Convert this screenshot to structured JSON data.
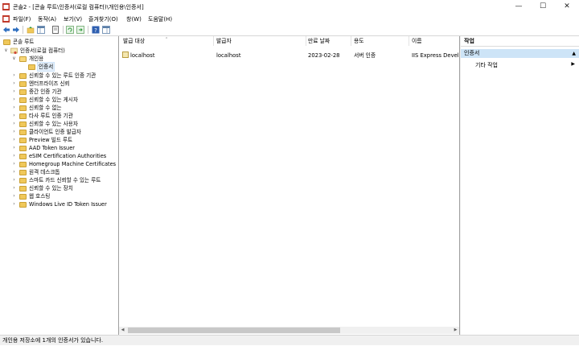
{
  "window": {
    "title": "콘솔2 - [콘솔 루트\\인증서(로컬 컴퓨터)\\개인용\\인증서]"
  },
  "menu": [
    "파일(F)",
    "동작(A)",
    "보기(V)",
    "즐겨찾기(O)",
    "창(W)",
    "도움말(H)"
  ],
  "tree": {
    "root": "콘솔 루트",
    "store": "인증서(로컬 컴퓨터)",
    "personal": "개인용",
    "certificates": "인증서",
    "folders": [
      "신뢰할 수 있는 루트 인증 기관",
      "엔터프라이즈 신뢰",
      "중간 인증 기관",
      "신뢰할 수 있는 게시자",
      "신뢰할 수 없는",
      "타사 루트 인증 기관",
      "신뢰할 수 있는 사용자",
      "클라이언트 인증 발급자",
      "Preview 빌드 루트",
      "AAD Token Issuer",
      "eSIM Certification Authorities",
      "Homegroup Machine Certificates",
      "원격 데스크톱",
      "스마트 카드 신뢰할 수 있는 루트",
      "신뢰할 수 있는 장치",
      "웹 호스팅",
      "Windows Live ID Token Issuer"
    ]
  },
  "list": {
    "columns": [
      "발급 대상",
      "발급자",
      "만료 날짜",
      "용도",
      "이름"
    ],
    "rows": [
      [
        "localhost",
        "localhost",
        "2023-02-28",
        "서버 인증",
        "IIS Express Develop"
      ]
    ]
  },
  "actions": {
    "header": "작업",
    "section": "인증서",
    "item": "기타 작업"
  },
  "status": {
    "text": "개인용 저장소에 1개의 인증서가 있습니다."
  }
}
